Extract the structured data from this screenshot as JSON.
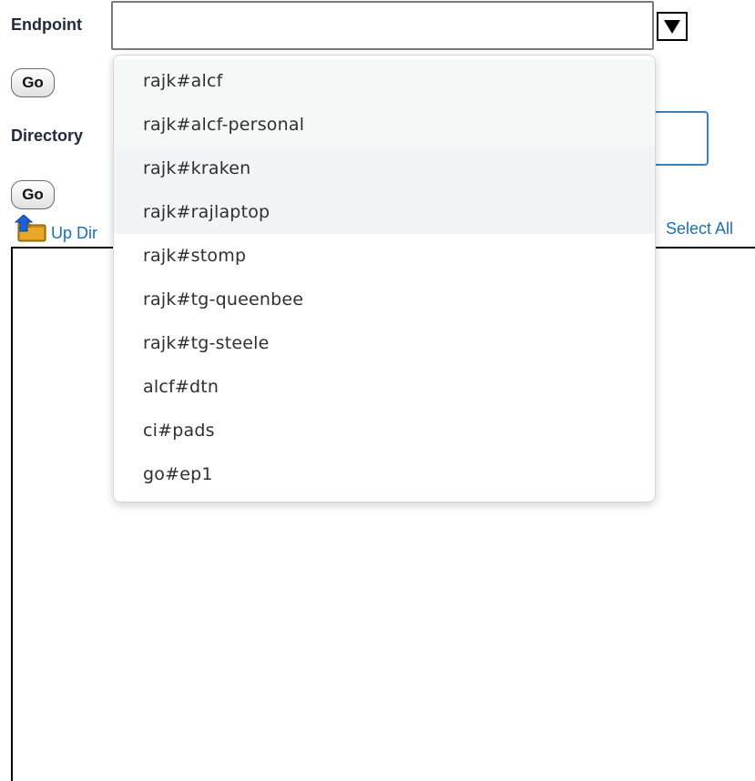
{
  "endpoint": {
    "label": "Endpoint",
    "value": "",
    "go_label": "Go",
    "options": [
      "rajk#alcf",
      "rajk#alcf-personal",
      "rajk#kraken",
      "rajk#rajlaptop",
      "rajk#stomp",
      "rajk#tg-queenbee",
      "rajk#tg-steele",
      "alcf#dtn",
      "ci#pads",
      "go#ep1"
    ]
  },
  "directory": {
    "label": "Directory",
    "value": "",
    "go_label": "Go"
  },
  "toolbar": {
    "up_directory_label": "Up Dir",
    "select_all_label": "Select All"
  },
  "icons": {
    "up_directory": "folder-up-arrow-icon",
    "dropdown": "triangle-down-icon"
  },
  "colors": {
    "link": "#1a6fb8",
    "label": "#1f2a3a",
    "focus_border": "#3d7fb8"
  }
}
